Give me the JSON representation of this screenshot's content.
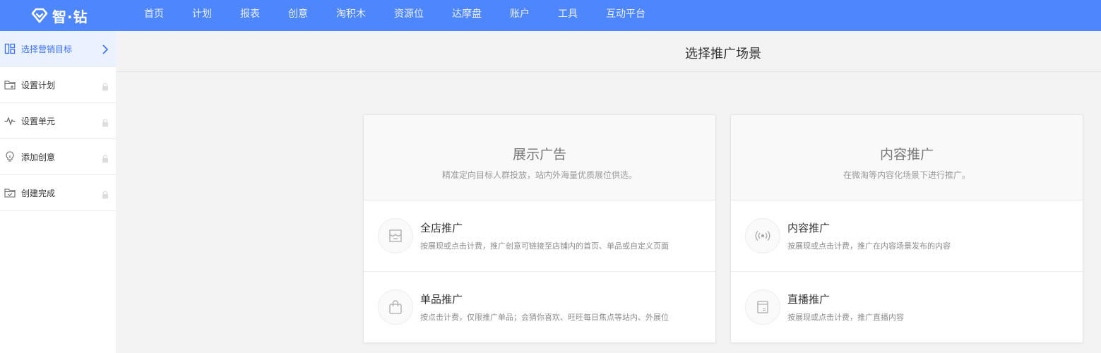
{
  "app": {
    "logo_text": "智·钻"
  },
  "nav": [
    "首页",
    "计划",
    "报表",
    "创意",
    "淘积木",
    "资源位",
    "达摩盘",
    "账户",
    "工具",
    "互动平台"
  ],
  "sidebar": {
    "steps": [
      {
        "label": "选择营销目标",
        "icon": "layout-icon",
        "state": "active"
      },
      {
        "label": "设置计划",
        "icon": "folder-plan-icon",
        "state": "locked"
      },
      {
        "label": "设置单元",
        "icon": "pulse-icon",
        "state": "locked"
      },
      {
        "label": "添加创意",
        "icon": "lightbulb-icon",
        "state": "locked"
      },
      {
        "label": "创建完成",
        "icon": "folder-check-icon",
        "state": "locked"
      }
    ]
  },
  "main": {
    "title": "选择推广场景",
    "cards": [
      {
        "title": "展示广告",
        "desc": "精准定向目标人群投放，站内外海量优质展位供选。",
        "options": [
          {
            "title": "全店推广",
            "desc": "按展现或点击计费，推广创意可链接至店铺内的首页、单品或自定义页面",
            "icon": "store-icon"
          },
          {
            "title": "单品推广",
            "desc": "按点击计费，仅限推广单品；会猜你喜欢、旺旺每日焦点等站内、外展位",
            "icon": "shopping-bag-icon"
          }
        ]
      },
      {
        "title": "内容推广",
        "desc": "在微淘等内容化场景下进行推广。",
        "options": [
          {
            "title": "内容推广",
            "desc": "按展现或点击计费，推广在内容场景发布的内容",
            "icon": "broadcast-icon"
          },
          {
            "title": "直播推广",
            "desc": "按展现或点击计费，推广直播内容",
            "icon": "document-icon"
          }
        ]
      }
    ]
  },
  "colors": {
    "accent": "#4e86fd",
    "active_bg": "#eaf2ff",
    "active_text": "#3c6ffb"
  }
}
